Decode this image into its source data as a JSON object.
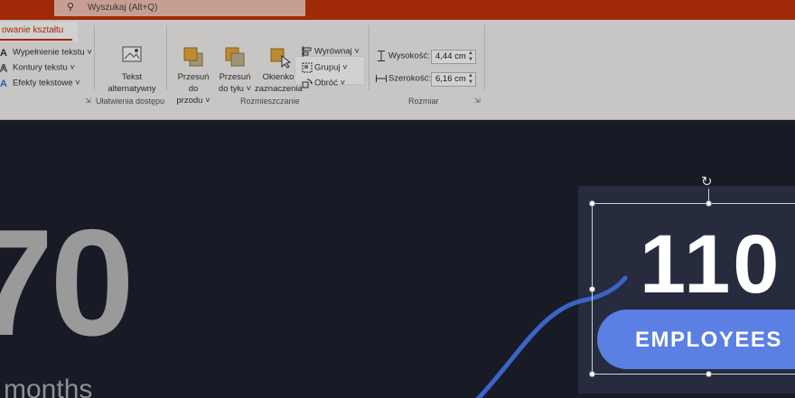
{
  "search": {
    "text": "Wyszukaj (Alt+Q)",
    "icon": "search-icon"
  },
  "tab": {
    "label": "owanie kształtu"
  },
  "ribbon": {
    "text_effects": {
      "fill": "Wypełnienie tekstu",
      "outline": "Kontury tekstu",
      "effects": "Efekty tekstowe"
    },
    "accessibility": {
      "alt_text_line1": "Tekst",
      "alt_text_line2": "alternatywny",
      "group_label": "Ułatwienia dostępu"
    },
    "arrange": {
      "bring_forward_line1": "Przesuń do",
      "bring_forward_line2": "przodu",
      "send_backward_line1": "Przesuń",
      "send_backward_line2": "do tyłu",
      "selection_pane_line1": "Okienko",
      "selection_pane_line2": "zaznaczenia",
      "align": "Wyrównaj",
      "group": "Grupuj",
      "rotate": "Obróć",
      "group_label": "Rozmieszczanie"
    },
    "size": {
      "height_label": "Wysokość:",
      "height_value": "4,44 cm",
      "width_label": "Szerokość:",
      "width_value": "6,16 cm",
      "group_label": "Rozmiar"
    }
  },
  "slide": {
    "left_number": "70",
    "left_caption": "months",
    "card_number": "110",
    "card_pill": "EMPLOYEES"
  },
  "colors": {
    "accent": "#c4320a",
    "pill": "#5b7fe3",
    "slide_bg": "#181a26",
    "card_bg": "#262c3e",
    "line": "#3d63c8"
  }
}
